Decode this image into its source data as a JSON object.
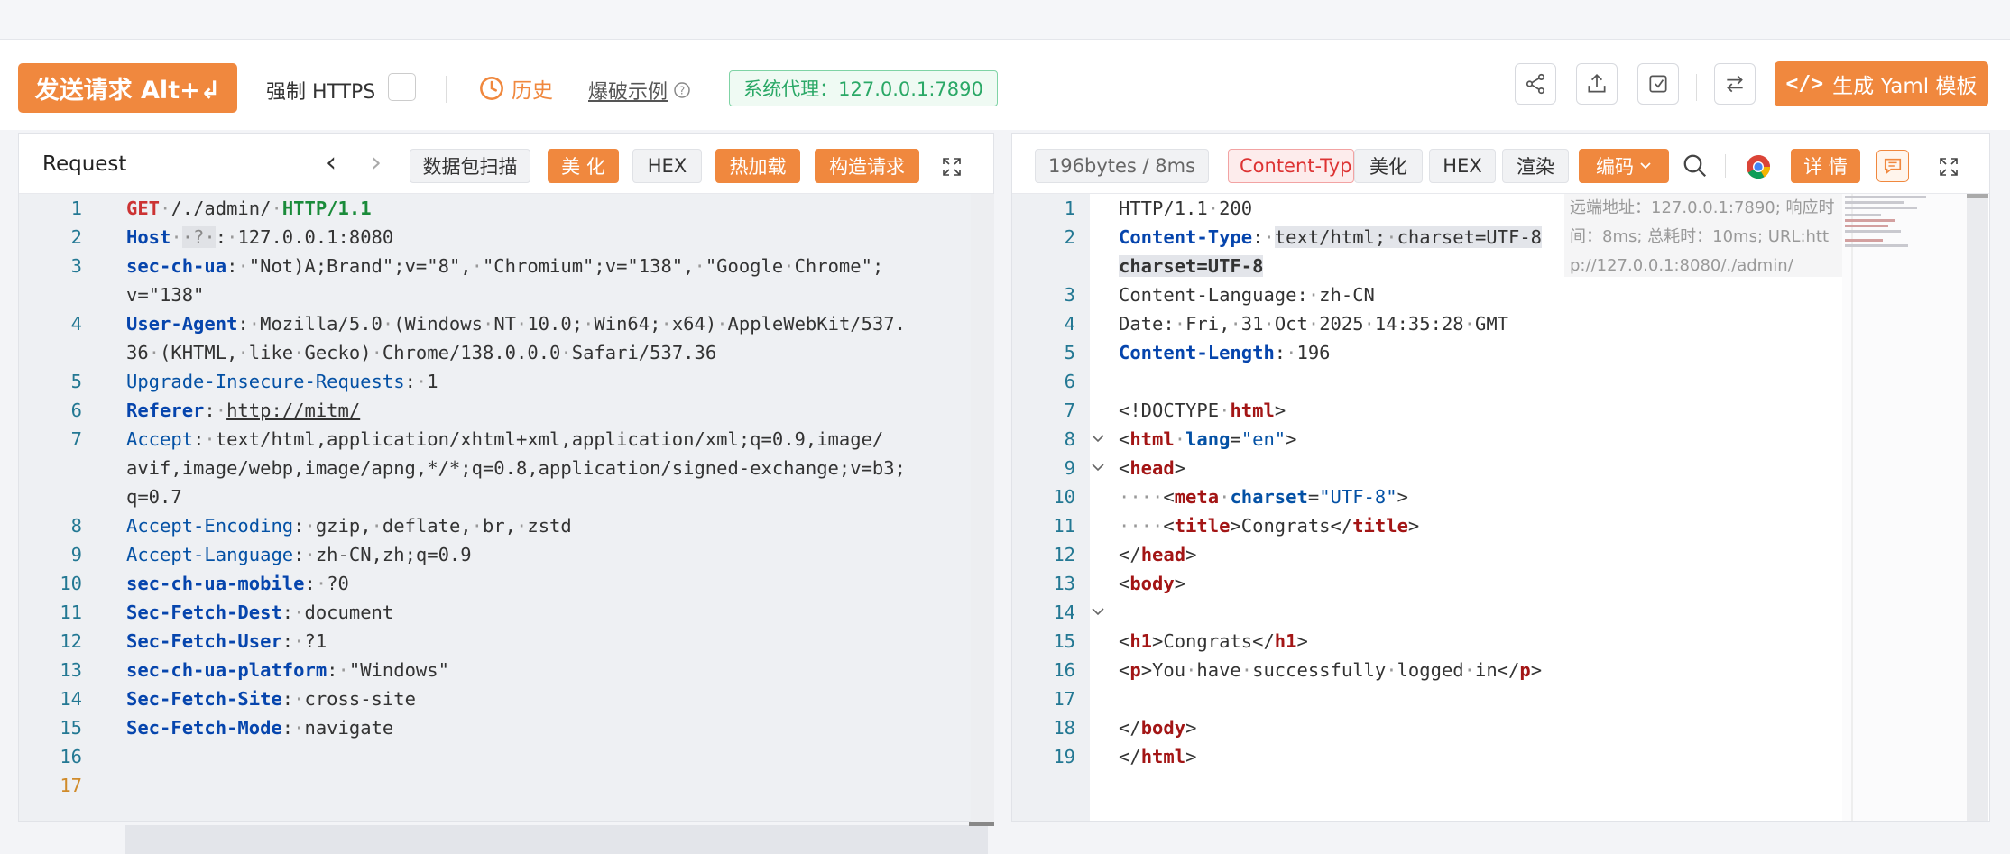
{
  "toolbar": {
    "send_label": "发送请求 Alt+↲",
    "force_https_label": "强制 HTTPS",
    "history_label": "历史",
    "fuzz_example_label": "爆破示例",
    "proxy_label": "系统代理：127.0.0.1:7890",
    "yaml_label": "生成 Yaml 模板"
  },
  "request": {
    "title": "Request",
    "buttons": [
      "数据包扫描",
      "美 化",
      "HEX",
      "热加载",
      "构造请求"
    ],
    "lines": [
      {
        "n": "1",
        "html": "<span class='m'>GET</span><span class='dim'>·</span>/./admin/<span class='dim'>·</span><span class='g'>HTTP/1.1</span>"
      },
      {
        "n": "2",
        "html": "<span class='k'>Host</span><span class='dim'>·</span><span style='background:#e0e2e6;color:#888'>·?·</span>:<span class='dim'>·</span>127.0.0.1:8080"
      },
      {
        "n": "3",
        "html": "<span class='k'>sec-ch-ua</span>:<span class='dim'>·</span>\"Not)A;Brand\";v=\"8\",<span class='dim'>·</span>\"Chromium\";v=\"138\",<span class='dim'>·</span>\"Google<span class='dim'>·</span>Chrome\";"
      },
      {
        "n": "",
        "html": "v=\"138\""
      },
      {
        "n": "4",
        "html": "<span class='k'>User-Agent</span>:<span class='dim'>·</span>Mozilla/5.0<span class='dim'>·</span>(Windows<span class='dim'>·</span>NT<span class='dim'>·</span>10.0;<span class='dim'>·</span>Win64;<span class='dim'>·</span>x64)<span class='dim'>·</span>AppleWebKit/537."
      },
      {
        "n": "",
        "html": "36<span class='dim'>·</span>(KHTML,<span class='dim'>·</span>like<span class='dim'>·</span>Gecko)<span class='dim'>·</span>Chrome/138.0.0.0<span class='dim'>·</span>Safari/537.36"
      },
      {
        "n": "5",
        "html": "<span class='kn'>Upgrade-Insecure-Requests</span>:<span class='dim'>·</span>1"
      },
      {
        "n": "6",
        "html": "<span class='k'>Referer</span>:<span class='dim'>·</span><span style='text-decoration:underline'>http://mitm/</span>"
      },
      {
        "n": "7",
        "html": "<span class='kn'>Accept</span>:<span class='dim'>·</span>text/html,application/xhtml+xml,application/xml;q=0.9,image/"
      },
      {
        "n": "",
        "html": "avif,image/webp,image/apng,*/*;q=0.8,application/signed-exchange;v=b3;"
      },
      {
        "n": "",
        "html": "q=0.7"
      },
      {
        "n": "8",
        "html": "<span class='kn'>Accept-Encoding</span>:<span class='dim'>·</span>gzip,<span class='dim'>·</span>deflate,<span class='dim'>·</span>br,<span class='dim'>·</span>zstd"
      },
      {
        "n": "9",
        "html": "<span class='kn'>Accept-Language</span>:<span class='dim'>·</span>zh-CN,zh;q=0.9"
      },
      {
        "n": "10",
        "html": "<span class='k'>sec-ch-ua-mobile</span>:<span class='dim'>·</span>?0"
      },
      {
        "n": "11",
        "html": "<span class='k'>Sec-Fetch-Dest</span>:<span class='dim'>·</span>document"
      },
      {
        "n": "12",
        "html": "<span class='k'>Sec-Fetch-User</span>:<span class='dim'>·</span>?1"
      },
      {
        "n": "13",
        "html": "<span class='k'>sec-ch-ua-platform</span>:<span class='dim'>·</span>\"Windows\""
      },
      {
        "n": "14",
        "html": "<span class='k'>Sec-Fetch-Site</span>:<span class='dim'>·</span>cross-site"
      },
      {
        "n": "15",
        "html": "<span class='k'>Sec-Fetch-Mode</span>:<span class='dim'>·</span>navigate"
      },
      {
        "n": "16",
        "html": ""
      },
      {
        "n": "17",
        "html": ""
      }
    ]
  },
  "response": {
    "size_label": "196bytes / 8ms",
    "content_type_tag": "Content-Typ",
    "buttons": [
      "美化",
      "HEX",
      "渲染",
      "编码",
      "详 情"
    ],
    "tooltip_lines": [
      "远端地址：127.0.0.1:7890; 响应时",
      "间：8ms; 总耗时：10ms; URL:htt",
      "p://127.0.0.1:8080/./admin/"
    ],
    "lines": [
      {
        "n": "1",
        "html": "HTTP/1.1<span class='dim'>·</span>200"
      },
      {
        "n": "2",
        "html": "<span class='k'>Content-Type</span>:<span class='dim'>·</span><span style='background:#e3e5ea'>text/html;<span class='dim'>·</span>charset=UTF-8</span>"
      },
      {
        "n": "",
        "html": "<span style='background:#e3e5ea;font-weight:bold'>charset=UTF-8</span>"
      },
      {
        "n": "3",
        "html": "Content-Language:<span class='dim'>·</span>zh-CN"
      },
      {
        "n": "4",
        "html": "Date:<span class='dim'>·</span>Fri,<span class='dim'>·</span>31<span class='dim'>·</span>Oct<span class='dim'>·</span>2025<span class='dim'>·</span>14:35:28<span class='dim'>·</span>GMT"
      },
      {
        "n": "5",
        "html": "<span class='k'>Content-Length</span>:<span class='dim'>·</span>196"
      },
      {
        "n": "6",
        "html": ""
      },
      {
        "n": "7",
        "html": "&lt;!DOCTYPE<span class='dim'>·</span><span class='tagc'>html</span>&gt;"
      },
      {
        "n": "8",
        "html": "&lt;<span class='tagc'>html</span><span class='dim'>·</span><span class='attr'>lang</span>=<span class='str'>\"en\"</span>&gt;"
      },
      {
        "n": "9",
        "html": "&lt;<span class='tagc'>head</span>&gt;"
      },
      {
        "n": "10",
        "html": "<span class='dim'>····</span>&lt;<span class='tagc'>meta</span><span class='dim'>·</span><span class='attr'>charset</span>=<span class='str'>\"UTF-8\"</span>&gt;"
      },
      {
        "n": "11",
        "html": "<span class='dim'>····</span>&lt;<span class='tagc'>title</span>&gt;Congrats&lt;/<span class='tagc'>title</span>&gt;"
      },
      {
        "n": "12",
        "html": "&lt;/<span class='tagc'>head</span>&gt;"
      },
      {
        "n": "13",
        "html": "&lt;<span class='tagc'>body</span>&gt;"
      },
      {
        "n": "14",
        "html": ""
      },
      {
        "n": "15",
        "html": "&lt;<span class='tagc'>h1</span>&gt;Congrats&lt;/<span class='tagc'>h1</span>&gt;"
      },
      {
        "n": "16",
        "html": "&lt;<span class='tagc'>p</span>&gt;You<span class='dim'>·</span>have<span class='dim'>·</span>successfully<span class='dim'>·</span>logged<span class='dim'>·</span>in&lt;/<span class='tagc'>p</span>&gt;"
      },
      {
        "n": "17",
        "html": ""
      },
      {
        "n": "18",
        "html": "&lt;/<span class='tagc'>body</span>&gt;"
      },
      {
        "n": "19",
        "html": "&lt;/<span class='tagc'>html</span>&gt;"
      }
    ]
  },
  "colors": {
    "accent": "#f0883e",
    "proxy_green": "#2aa866"
  }
}
